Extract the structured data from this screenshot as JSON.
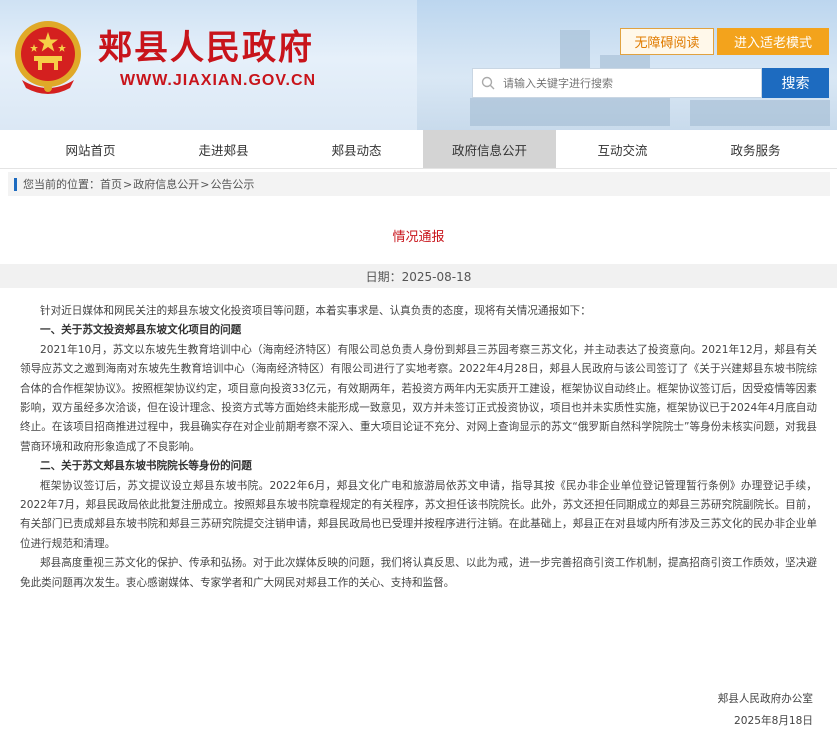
{
  "site": {
    "title": "郏县人民政府",
    "url": "WWW.JIAXIAN.GOV.CN"
  },
  "header": {
    "accessibility_label": "无障碍阅读",
    "elder_mode_label": "进入适老模式",
    "search_placeholder": "请输入关键字进行搜索",
    "search_button": "搜索"
  },
  "nav": {
    "items": [
      {
        "label": "网站首页"
      },
      {
        "label": "走进郏县"
      },
      {
        "label": "郏县动态"
      },
      {
        "label": "政府信息公开"
      },
      {
        "label": "互动交流"
      },
      {
        "label": "政务服务"
      }
    ],
    "active_index": 3
  },
  "breadcrumb": {
    "prefix": "您当前的位置：",
    "items": [
      "首页",
      "政府信息公开",
      "公告公示"
    ],
    "separator": ">"
  },
  "article": {
    "title": "情况通报",
    "date": "日期：2025-08-18",
    "intro": "针对近日媒体和网民关注的郏县东坡文化投资项目等问题，本着实事求是、认真负责的态度，现将有关情况通报如下：",
    "section1_heading": "一、关于苏文投资郏县东坡文化项目的问题",
    "section1_body": "2021年10月，苏文以东坡先生教育培训中心（海南经济特区）有限公司总负责人身份到郏县三苏园考察三苏文化，并主动表达了投资意向。2021年12月，郏县有关领导应苏文之邀到海南对东坡先生教育培训中心（海南经济特区）有限公司进行了实地考察。2022年4月28日，郏县人民政府与该公司签订了《关于兴建郏县东坡书院综合体的合作框架协议》。按照框架协议约定，项目意向投资33亿元，有效期两年，若投资方两年内无实质开工建设，框架协议自动终止。框架协议签订后，因受疫情等因素影响，双方虽经多次洽谈，但在设计理念、投资方式等方面始终未能形成一致意见，双方并未签订正式投资协议，项目也并未实质性实施，框架协议已于2024年4月底自动终止。在该项目招商推进过程中，我县确实存在对企业前期考察不深入、重大项目论证不充分、对网上查询显示的苏文“俄罗斯自然科学院院士”等身份未核实问题，对我县营商环境和政府形象造成了不良影响。",
    "section2_heading": "二、关于苏文郏县东坡书院院长等身份的问题",
    "section2_body": "框架协议签订后，苏文提议设立郏县东坡书院。2022年6月，郏县文化广电和旅游局依苏文申请，指导其按《民办非企业单位登记管理暂行条例》办理登记手续，2022年7月，郏县民政局依此批复注册成立。按照郏县东坡书院章程规定的有关程序，苏文担任该书院院长。此外，苏文还担任同期成立的郏县三苏研究院副院长。目前，有关部门已责成郏县东坡书院和郏县三苏研究院提交注销申请，郏县民政局也已受理并按程序进行注销。在此基础上，郏县正在对县域内所有涉及三苏文化的民办非企业单位进行规范和清理。",
    "closing": "郏县高度重视三苏文化的保护、传承和弘扬。对于此次媒体反映的问题，我们将认真反思、以此为戒，进一步完善招商引资工作机制，提高招商引资工作质效，坚决避免此类问题再次发生。衷心感谢媒体、专家学者和广大网民对郏县工作的关心、支持和监督。",
    "signature_org": "郏县人民政府办公室",
    "signature_date": "2025年8月18日"
  },
  "colors": {
    "brand_red": "#c8141b",
    "search_blue": "#1d6bc0",
    "elder_orange": "#f3a31c",
    "nav_active": "#d4d4d4"
  },
  "icons": [
    "national-emblem-icon",
    "search-icon"
  ]
}
